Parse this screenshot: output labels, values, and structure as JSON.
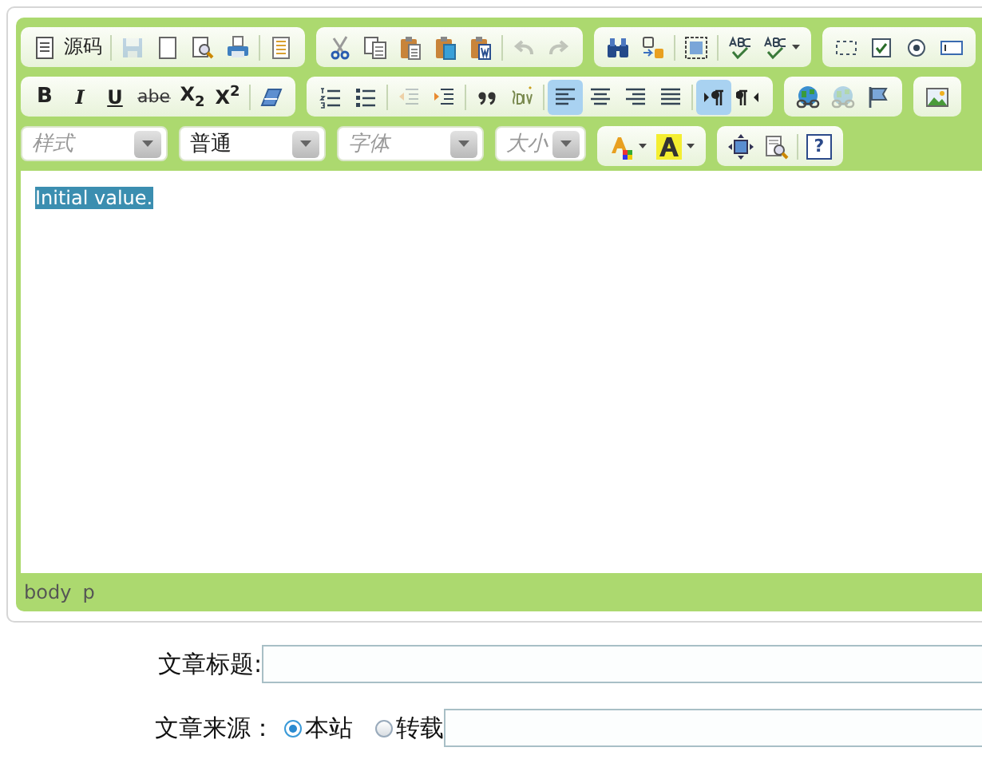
{
  "editor": {
    "toolbar": [
      [
        {
          "items": [
            {
              "kind": "labeled",
              "label": "源码",
              "selected": false,
              "disabled": false
            },
            {
              "kind": "separator"
            },
            {
              "kind": "icon",
              "selected": false,
              "disabled": true
            },
            {
              "kind": "icon",
              "selected": false,
              "disabled": false
            },
            {
              "kind": "icon",
              "selected": false,
              "disabled": false
            },
            {
              "kind": "icon",
              "selected": false,
              "disabled": false
            },
            {
              "kind": "separator"
            },
            {
              "kind": "icon",
              "selected": false,
              "disabled": false
            }
          ]
        },
        {
          "items": [
            {
              "kind": "icon",
              "selected": false,
              "disabled": false
            },
            {
              "kind": "icon",
              "selected": false,
              "disabled": false
            },
            {
              "kind": "icon",
              "selected": false,
              "disabled": false
            },
            {
              "kind": "icon",
              "selected": false,
              "disabled": false
            },
            {
              "kind": "icon",
              "selected": false,
              "disabled": false
            },
            {
              "kind": "separator"
            },
            {
              "kind": "icon",
              "selected": false,
              "disabled": true
            },
            {
              "kind": "icon",
              "selected": false,
              "disabled": true
            }
          ]
        },
        {
          "items": [
            {
              "kind": "icon",
              "selected": false,
              "disabled": false
            },
            {
              "kind": "icon",
              "selected": false,
              "disabled": false
            },
            {
              "kind": "separator"
            },
            {
              "kind": "icon",
              "selected": false,
              "disabled": false
            },
            {
              "kind": "separator"
            },
            {
              "kind": "icon",
              "selected": false,
              "disabled": false
            },
            {
              "kind": "menu",
              "selected": false,
              "disabled": false
            }
          ]
        },
        {
          "items": [
            {
              "kind": "icon",
              "selected": false,
              "disabled": false
            },
            {
              "kind": "icon",
              "selected": false,
              "disabled": false
            },
            {
              "kind": "icon",
              "selected": false,
              "disabled": false
            },
            {
              "kind": "icon",
              "selected": false,
              "disabled": false
            }
          ]
        }
      ],
      [
        {
          "items": [
            {
              "kind": "bold",
              "label": "B",
              "selected": false,
              "disabled": false
            },
            {
              "kind": "italic",
              "label": "I",
              "selected": false,
              "disabled": false
            },
            {
              "kind": "underline",
              "label": "U",
              "selected": false,
              "disabled": false
            },
            {
              "kind": "strike",
              "label": "abe",
              "selected": false,
              "disabled": false
            },
            {
              "kind": "script",
              "label": "X$_{2}$",
              "selected": false,
              "disabled": false
            },
            {
              "kind": "script",
              "label": "X$^{2}$",
              "selected": false,
              "disabled": false
            },
            {
              "kind": "separator"
            },
            {
              "kind": "icon",
              "selected": false,
              "disabled": false
            }
          ]
        },
        {
          "items": [
            {
              "kind": "icon",
              "selected": false,
              "disabled": false
            },
            {
              "kind": "icon",
              "selected": false,
              "disabled": false
            },
            {
              "kind": "separator"
            },
            {
              "kind": "icon",
              "selected": false,
              "disabled": true
            },
            {
              "kind": "icon",
              "selected": false,
              "disabled": false
            },
            {
              "kind": "separator"
            },
            {
              "kind": "icon",
              "selected": false,
              "disabled": false
            },
            {
              "kind": "icon",
              "selected": false,
              "disabled": false
            },
            {
              "kind": "separator"
            },
            {
              "kind": "icon",
              "selected": true,
              "disabled": false
            },
            {
              "kind": "icon",
              "selected": false,
              "disabled": false
            },
            {
              "kind": "icon",
              "selected": false,
              "disabled": false
            },
            {
              "kind": "icon",
              "selected": false,
              "disabled": false
            },
            {
              "kind": "separator"
            },
            {
              "kind": "icon",
              "selected": true,
              "disabled": false
            },
            {
              "kind": "icon",
              "selected": false,
              "disabled": false
            }
          ]
        },
        {
          "items": [
            {
              "kind": "icon",
              "selected": false,
              "disabled": false
            },
            {
              "kind": "icon",
              "selected": false,
              "disabled": true
            },
            {
              "kind": "icon",
              "selected": false,
              "disabled": false
            }
          ]
        },
        {
          "items": [
            {
              "kind": "icon",
              "selected": false,
              "disabled": false
            }
          ]
        }
      ],
      [
        {
          "combo": {
            "placeholder": "样式"
          }
        },
        {
          "combo": {
            "value": "普通"
          }
        },
        {
          "combo": {
            "placeholder": "字体"
          }
        },
        {
          "combo": {
            "placeholder": "大小"
          }
        },
        {
          "items": [
            {
              "kind": "menu",
              "selected": false,
              "disabled": false
            },
            {
              "kind": "menu",
              "selected": false,
              "disabled": false
            }
          ]
        },
        {
          "items": [
            {
              "kind": "icon",
              "selected": false,
              "disabled": false
            },
            {
              "kind": "icon",
              "selected": false,
              "disabled": false
            },
            {
              "kind": "separator"
            },
            {
              "kind": "help",
              "label": "?",
              "selected": false,
              "disabled": false
            }
          ]
        }
      ]
    ],
    "content": {
      "text": "Initial value.",
      "selected": true
    },
    "path": [
      "body",
      "p"
    ]
  },
  "form": [
    {
      "label": "文章标题:"
    },
    {
      "label": "文章来源：",
      "options": [
        {
          "label": "本站",
          "selected": true
        },
        {
          "label": "转载",
          "selected": false
        }
      ]
    }
  ]
}
